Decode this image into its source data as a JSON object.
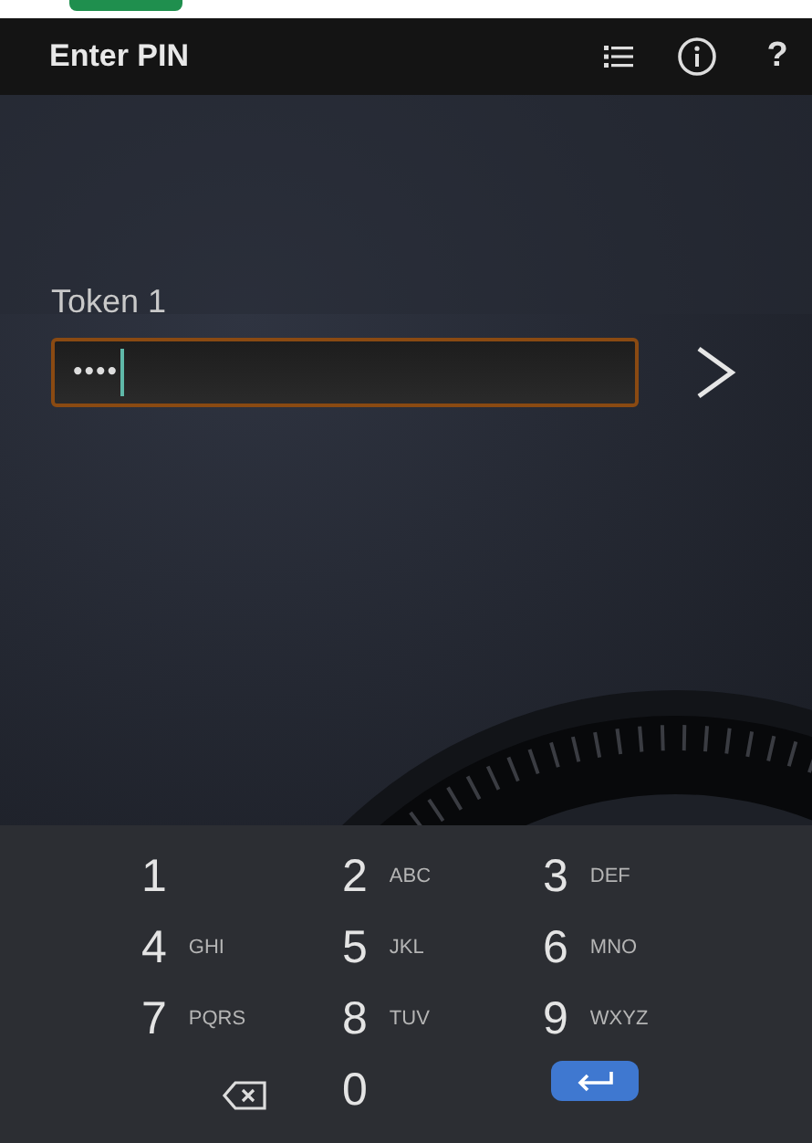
{
  "app_bar": {
    "title": "Enter PIN",
    "help": "?"
  },
  "token": {
    "label": "Token 1",
    "value": "••••",
    "focused": true
  },
  "keypad": {
    "keys": [
      {
        "kind": "digit",
        "digit": "1"
      },
      {
        "kind": "digit",
        "digit": "2",
        "letters": "ABC"
      },
      {
        "kind": "digit",
        "digit": "3",
        "letters": "DEF"
      },
      {
        "kind": "digit",
        "digit": "4",
        "letters": "GHI"
      },
      {
        "kind": "digit",
        "digit": "5",
        "letters": "JKL"
      },
      {
        "kind": "digit",
        "digit": "6",
        "letters": "MNO"
      },
      {
        "kind": "digit",
        "digit": "7",
        "letters": "PQRS"
      },
      {
        "kind": "digit",
        "digit": "8",
        "letters": "TUV"
      },
      {
        "kind": "digit",
        "digit": "9",
        "letters": "WXYZ"
      },
      {
        "kind": "backspace"
      },
      {
        "kind": "digit",
        "digit": "0"
      },
      {
        "kind": "enter"
      }
    ]
  }
}
